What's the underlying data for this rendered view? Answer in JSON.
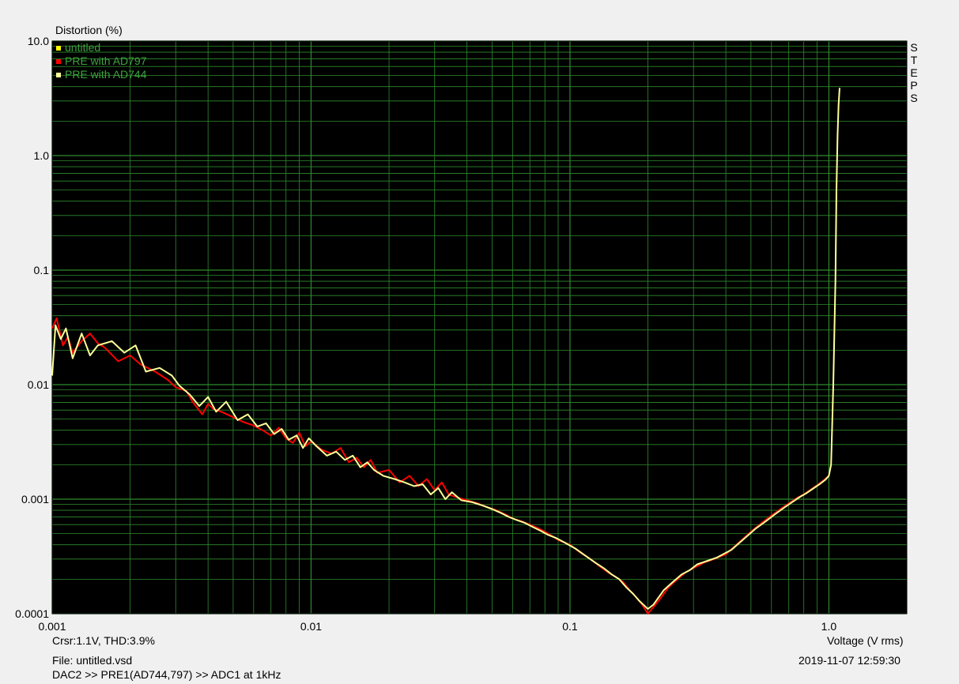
{
  "chart_data": {
    "type": "line",
    "ylabel": "Distortion (%)",
    "xlabel": "Voltage (V rms)",
    "x_scale": "log",
    "y_scale": "log",
    "xlim": [
      0.001,
      2
    ],
    "ylim": [
      0.0001,
      10
    ],
    "x_ticks": [
      {
        "value": 0.001,
        "label": "0.001"
      },
      {
        "value": 0.01,
        "label": "0.01"
      },
      {
        "value": 0.1,
        "label": "0.1"
      },
      {
        "value": 1.0,
        "label": "1.0"
      }
    ],
    "y_ticks": [
      {
        "value": 0.0001,
        "label": "0.0001"
      },
      {
        "value": 0.001,
        "label": "0.001"
      },
      {
        "value": 0.01,
        "label": "0.01"
      },
      {
        "value": 0.1,
        "label": "0.1"
      },
      {
        "value": 1.0,
        "label": "1.0"
      },
      {
        "value": 10.0,
        "label": "10.0"
      }
    ],
    "grid": true,
    "background": "#000000",
    "grid_color": "#2e8b2e",
    "legend": "top-left",
    "legend_entries": [
      {
        "name": "untitled",
        "color": "#ffff00"
      },
      {
        "name": "PRE with AD797",
        "color": "#ff0000"
      },
      {
        "name": "PRE with AD744",
        "color": "#ffff99"
      }
    ],
    "right_label": "STEPS",
    "series": [
      {
        "name": "PRE with AD797",
        "color": "#ff0000",
        "x": [
          0.001,
          0.00104,
          0.0011,
          0.00115,
          0.0012,
          0.0013,
          0.0014,
          0.0015,
          0.0016,
          0.0018,
          0.002,
          0.0022,
          0.0025,
          0.0028,
          0.003,
          0.0033,
          0.0035,
          0.0038,
          0.004,
          0.0042,
          0.0045,
          0.005,
          0.0055,
          0.006,
          0.0065,
          0.007,
          0.0075,
          0.008,
          0.0085,
          0.009,
          0.0095,
          0.01,
          0.011,
          0.012,
          0.013,
          0.014,
          0.015,
          0.016,
          0.017,
          0.018,
          0.02,
          0.022,
          0.024,
          0.026,
          0.028,
          0.03,
          0.032,
          0.034,
          0.036,
          0.04,
          0.044,
          0.048,
          0.052,
          0.056,
          0.06,
          0.065,
          0.07,
          0.075,
          0.08,
          0.085,
          0.09,
          0.1,
          0.11,
          0.12,
          0.13,
          0.14,
          0.15,
          0.16,
          0.17,
          0.18,
          0.19,
          0.2,
          0.22,
          0.24,
          0.26,
          0.28,
          0.3,
          0.33,
          0.36,
          0.4,
          0.45,
          0.5,
          0.55,
          0.6,
          0.65,
          0.7,
          0.75,
          0.8,
          0.85,
          0.9,
          0.95,
          1.0
        ],
        "values": [
          0.031,
          0.038,
          0.022,
          0.026,
          0.019,
          0.024,
          0.028,
          0.023,
          0.021,
          0.016,
          0.018,
          0.015,
          0.013,
          0.011,
          0.0095,
          0.0088,
          0.007,
          0.0055,
          0.0068,
          0.0061,
          0.0058,
          0.0052,
          0.0047,
          0.0044,
          0.004,
          0.0036,
          0.0042,
          0.0034,
          0.0031,
          0.0038,
          0.0029,
          0.0032,
          0.0027,
          0.0025,
          0.0028,
          0.0021,
          0.0023,
          0.0019,
          0.0022,
          0.0017,
          0.0018,
          0.0014,
          0.0016,
          0.0013,
          0.0015,
          0.0012,
          0.0014,
          0.0011,
          0.00105,
          0.00098,
          0.00092,
          0.00085,
          0.0008,
          0.00074,
          0.00068,
          0.00064,
          0.0006,
          0.00056,
          0.00052,
          0.00048,
          0.00044,
          0.0004,
          0.00034,
          0.0003,
          0.00026,
          0.00023,
          0.00021,
          0.00019,
          0.00016,
          0.00014,
          0.00012,
          0.0001,
          0.00013,
          0.00017,
          0.0002,
          0.00023,
          0.00025,
          0.00028,
          0.0003,
          0.00033,
          0.00042,
          0.00052,
          0.00062,
          0.00072,
          0.00082,
          0.00092,
          0.00102,
          0.0011,
          0.00121,
          0.00132,
          0.00145,
          0.0016
        ]
      },
      {
        "name": "PRE with AD744",
        "color": "#ffff99",
        "x": [
          0.001,
          0.00103,
          0.00108,
          0.00113,
          0.0012,
          0.0013,
          0.0014,
          0.0015,
          0.0017,
          0.0019,
          0.0021,
          0.0023,
          0.0026,
          0.0029,
          0.0031,
          0.0034,
          0.0037,
          0.004,
          0.0043,
          0.0047,
          0.0052,
          0.0057,
          0.0062,
          0.0067,
          0.0072,
          0.0077,
          0.0082,
          0.0088,
          0.0093,
          0.0098,
          0.0105,
          0.0115,
          0.0125,
          0.0135,
          0.0145,
          0.0155,
          0.0165,
          0.0175,
          0.019,
          0.021,
          0.023,
          0.025,
          0.027,
          0.029,
          0.031,
          0.033,
          0.035,
          0.038,
          0.042,
          0.046,
          0.05,
          0.054,
          0.058,
          0.062,
          0.067,
          0.072,
          0.077,
          0.082,
          0.088,
          0.095,
          0.105,
          0.115,
          0.125,
          0.135,
          0.145,
          0.155,
          0.165,
          0.175,
          0.185,
          0.2,
          0.21,
          0.23,
          0.25,
          0.27,
          0.29,
          0.31,
          0.34,
          0.37,
          0.42,
          0.47,
          0.52,
          0.57,
          0.62,
          0.67,
          0.72,
          0.77,
          0.82,
          0.87,
          0.92,
          0.97,
          1.0,
          1.02,
          1.04,
          1.06,
          1.07,
          1.08,
          1.09,
          1.1
        ],
        "values": [
          0.012,
          0.033,
          0.025,
          0.031,
          0.017,
          0.028,
          0.018,
          0.022,
          0.024,
          0.019,
          0.022,
          0.013,
          0.014,
          0.012,
          0.0098,
          0.0082,
          0.0065,
          0.0078,
          0.0058,
          0.0071,
          0.0049,
          0.0055,
          0.0043,
          0.0046,
          0.0037,
          0.0041,
          0.0033,
          0.0036,
          0.0028,
          0.0034,
          0.0029,
          0.0024,
          0.0026,
          0.0022,
          0.0024,
          0.0019,
          0.0021,
          0.0018,
          0.0016,
          0.0015,
          0.0014,
          0.0013,
          0.00135,
          0.0011,
          0.00125,
          0.001,
          0.00115,
          0.00098,
          0.00094,
          0.00088,
          0.00082,
          0.00076,
          0.0007,
          0.00066,
          0.00062,
          0.00057,
          0.00053,
          0.00049,
          0.00046,
          0.00042,
          0.00037,
          0.00032,
          0.00028,
          0.00025,
          0.00022,
          0.0002,
          0.00017,
          0.00015,
          0.00013,
          0.00011,
          0.00012,
          0.00016,
          0.00019,
          0.00022,
          0.00024,
          0.00027,
          0.00029,
          0.00031,
          0.00036,
          0.00045,
          0.00055,
          0.00064,
          0.00074,
          0.00084,
          0.00094,
          0.00104,
          0.00113,
          0.00124,
          0.00135,
          0.00148,
          0.0016,
          0.002,
          0.01,
          0.08,
          0.5,
          1.5,
          2.8,
          3.9
        ]
      }
    ]
  },
  "cursor_readout": "Crsr:1.1V, THD:3.9%",
  "file_name": "File: untitled.vsd",
  "signal_chain": "DAC2 >> PRE1(AD744,797) >> ADC1 at 1kHz",
  "timestamp": "2019-11-07  12:59:30"
}
